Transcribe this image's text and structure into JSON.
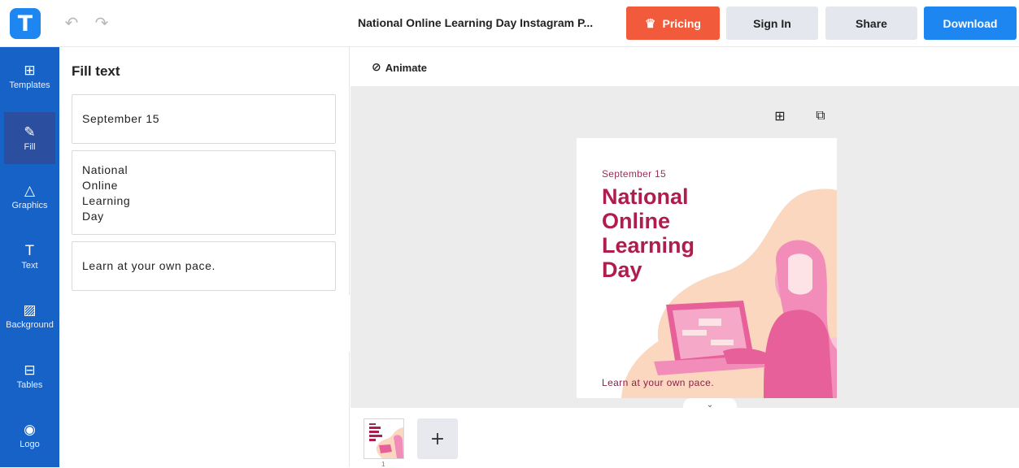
{
  "app": {
    "logo_letter": "T",
    "document_title": "National Online Learning Day Instagram P..."
  },
  "toolbar": {
    "undo_icon": "↶",
    "redo_icon": "↷",
    "pricing_label": "Pricing",
    "pricing_icon": "♛",
    "signin_label": "Sign In",
    "share_label": "Share",
    "download_label": "Download"
  },
  "sidebar": {
    "items": [
      {
        "label": "Templates",
        "icon": "⊞",
        "icon_name": "templates-icon"
      },
      {
        "label": "Fill",
        "icon": "✎",
        "icon_name": "pencil-icon"
      },
      {
        "label": "Graphics",
        "icon": "△",
        "icon_name": "shapes-icon"
      },
      {
        "label": "Text",
        "icon": "T",
        "icon_name": "text-icon"
      },
      {
        "label": "Background",
        "icon": "▨",
        "icon_name": "background-icon"
      },
      {
        "label": "Tables",
        "icon": "⊟",
        "icon_name": "table-icon"
      },
      {
        "label": "Logo",
        "icon": "◉",
        "icon_name": "logo-icon"
      }
    ],
    "active": "Fill",
    "bg_color": "#1762c6"
  },
  "panel": {
    "title": "Fill text",
    "fields": [
      "September 15",
      "National\nOnline\nLearning\nDay",
      "Learn at your own pace."
    ],
    "collapse_icon": "‹"
  },
  "workspace": {
    "animate_label": "Animate",
    "animate_icon": "⊘",
    "add_icon": "⊞",
    "duplicate_icon": "⧉",
    "expand_icon": "⌄"
  },
  "artboard": {
    "date": "September 15",
    "title": "National\nOnline\nLearning\nDay",
    "tagline": "Learn at your own pace.",
    "colors": {
      "accent": "#b01c4f",
      "peach": "#fbd7bf",
      "pink": "#f28cb8",
      "magenta": "#e8609a"
    }
  },
  "pages": {
    "page_number": "1",
    "add_icon": "+"
  },
  "colors": {
    "brand_blue": "#1d86f0",
    "pricing_orange": "#f15a3a",
    "secondary_button": "#e4e7ee"
  }
}
